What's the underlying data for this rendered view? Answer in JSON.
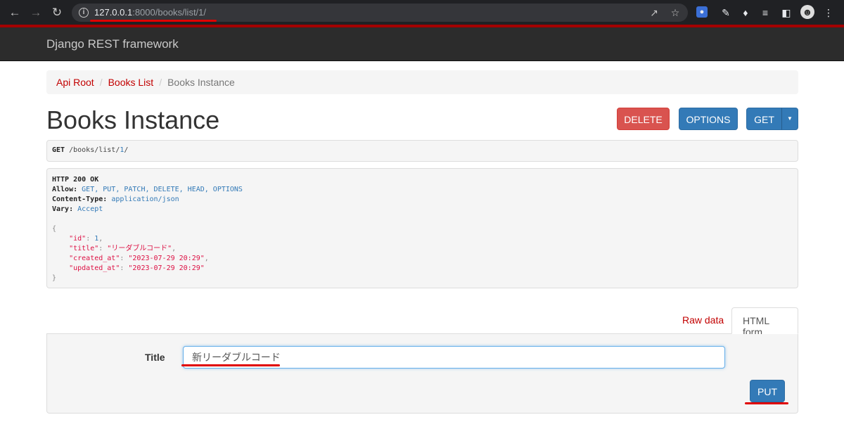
{
  "browser": {
    "url_host": "127.0.0.1",
    "url_rest": ":8000/books/list/1/"
  },
  "navbar": {
    "brand": "Django REST framework"
  },
  "breadcrumb": {
    "items": [
      "Api Root",
      "Books List",
      "Books Instance"
    ],
    "separator": "/"
  },
  "page": {
    "title": "Books Instance"
  },
  "buttons": {
    "delete": "DELETE",
    "options": "OPTIONS",
    "get": "GET",
    "put": "PUT"
  },
  "request": {
    "method": "GET",
    "path": "/books/list/",
    "id": "1",
    "trailing": "/"
  },
  "response": {
    "status": "HTTP 200 OK",
    "allow_label": "Allow:",
    "allow_value": "GET, PUT, PATCH, DELETE, HEAD, OPTIONS",
    "content_type_label": "Content-Type:",
    "content_type_value": "application/json",
    "vary_label": "Vary:",
    "vary_value": "Accept",
    "body": {
      "open": "{",
      "id_key": "\"id\"",
      "id_value": "1",
      "title_key": "\"title\"",
      "title_value": "\"リーダブルコード\"",
      "created_key": "\"created_at\"",
      "created_value": "\"2023-07-29 20:29\"",
      "updated_key": "\"updated_at\"",
      "updated_value": "\"2023-07-29 20:29\"",
      "close": "}"
    }
  },
  "tabs": {
    "raw": "Raw data",
    "html": "HTML form"
  },
  "form": {
    "title_label": "Title",
    "title_value": "新リーダブルコード"
  },
  "colors": {
    "annotation": "#e00000",
    "danger": "#d9534f",
    "primary": "#337ab7",
    "link": "#c20000"
  }
}
